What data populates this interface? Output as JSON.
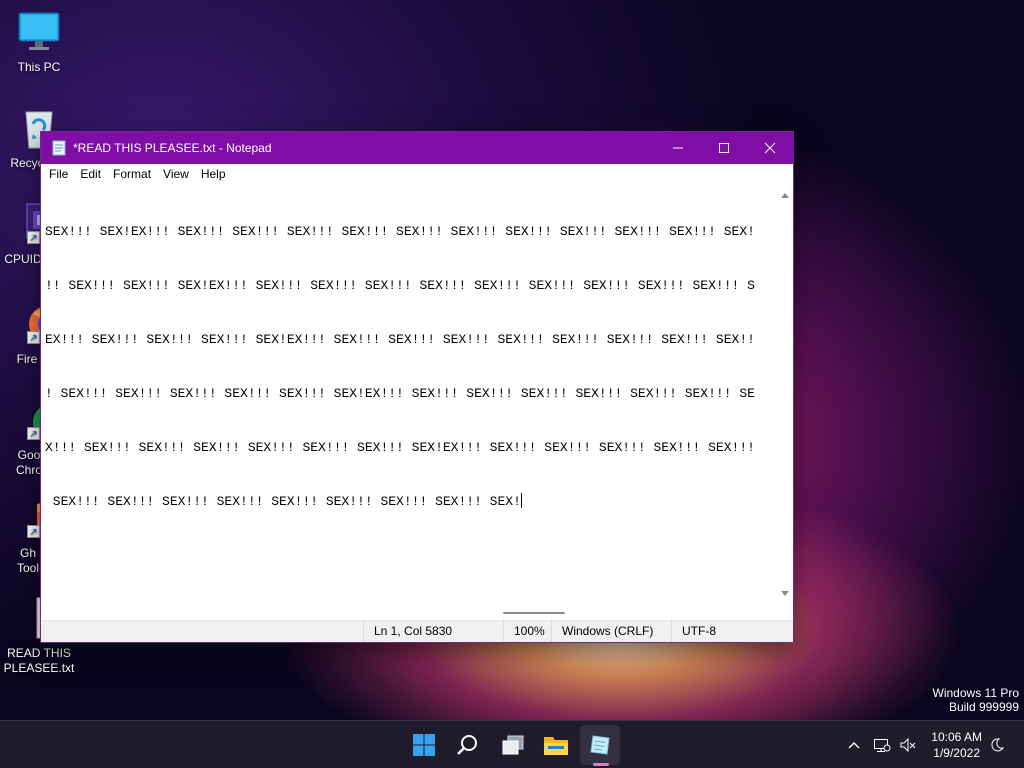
{
  "desktop": {
    "icons": [
      {
        "label": "This PC"
      },
      {
        "label": "Recyc"
      },
      {
        "label": "CPUID"
      },
      {
        "label": "Fire"
      },
      {
        "label": "Goo\nChro"
      },
      {
        "label": "Gh\nTool"
      },
      {
        "label": "READ THIS\nPLEASEE.txt"
      }
    ]
  },
  "notepad": {
    "title": "*READ THIS PLEASEE.txt - Notepad",
    "menu": [
      "File",
      "Edit",
      "Format",
      "View",
      "Help"
    ],
    "lines": [
      "SEX!!! SEX!EX!!! SEX!!! SEX!!! SEX!!! SEX!!! SEX!!! SEX!!! SEX!!! SEX!!! SEX!!! SEX!!! SEX!",
      "!! SEX!!! SEX!!! SEX!EX!!! SEX!!! SEX!!! SEX!!! SEX!!! SEX!!! SEX!!! SEX!!! SEX!!! SEX!!! S",
      "EX!!! SEX!!! SEX!!! SEX!!! SEX!EX!!! SEX!!! SEX!!! SEX!!! SEX!!! SEX!!! SEX!!! SEX!!! SEX!!",
      "! SEX!!! SEX!!! SEX!!! SEX!!! SEX!!! SEX!EX!!! SEX!!! SEX!!! SEX!!! SEX!!! SEX!!! SEX!!! SE",
      "X!!! SEX!!! SEX!!! SEX!!! SEX!!! SEX!!! SEX!!! SEX!EX!!! SEX!!! SEX!!! SEX!!! SEX!!! SEX!!!",
      " SEX!!! SEX!!! SEX!!! SEX!!! SEX!!! SEX!!! SEX!!! SEX!!! SEX!"
    ],
    "status": {
      "position": "Ln 1, Col 5830",
      "zoom": "100%",
      "line_ending": "Windows (CRLF)",
      "encoding": "UTF-8"
    }
  },
  "watermark": {
    "line1": "Windows 11 Pro",
    "line2": "Build 999999"
  },
  "taskbar": {
    "time": "10:06 AM",
    "date": "1/9/2022"
  },
  "colors": {
    "titlebar": "#7e0ea6",
    "taskbar": "#201c2c",
    "indicator": "#ff6ec7"
  }
}
